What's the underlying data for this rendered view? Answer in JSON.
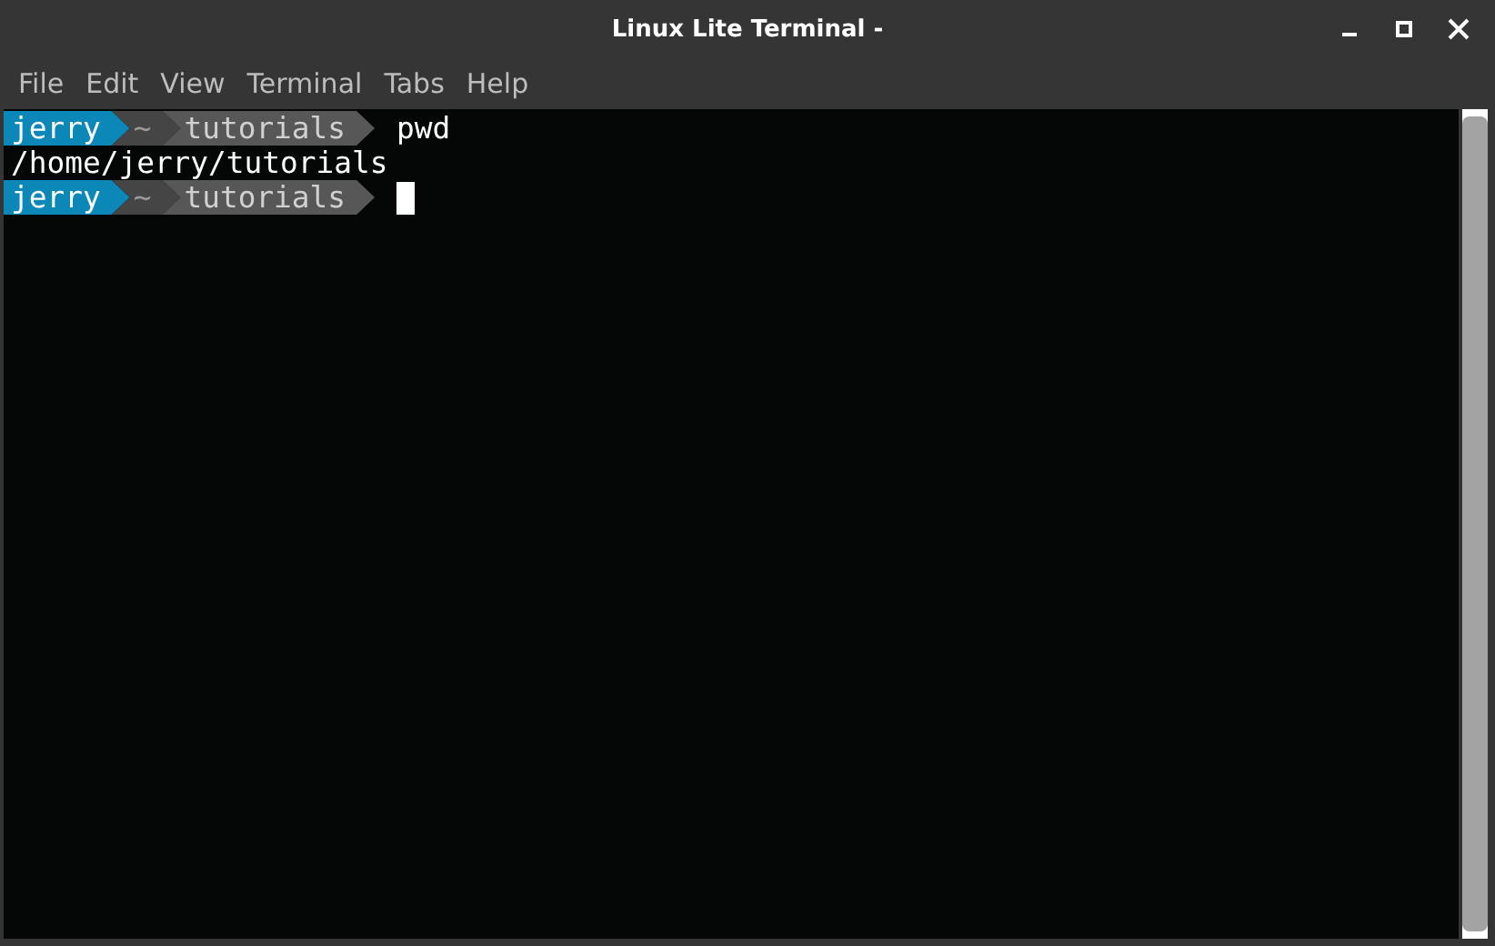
{
  "window": {
    "title": "Linux Lite Terminal -"
  },
  "menu": [
    "File",
    "Edit",
    "View",
    "Terminal",
    "Tabs",
    "Help"
  ],
  "lines": [
    {
      "kind": "prompt",
      "segments": [
        {
          "kind": "user",
          "text": "jerry"
        },
        {
          "kind": "home",
          "text": "~"
        },
        {
          "kind": "dir",
          "text": "tutorials"
        }
      ],
      "command": "pwd",
      "cursor": false
    },
    {
      "kind": "output",
      "text": "/home/jerry/tutorials"
    },
    {
      "kind": "prompt",
      "segments": [
        {
          "kind": "user",
          "text": "jerry"
        },
        {
          "kind": "home",
          "text": "~"
        },
        {
          "kind": "dir",
          "text": "tutorials"
        }
      ],
      "cursor": true
    }
  ]
}
